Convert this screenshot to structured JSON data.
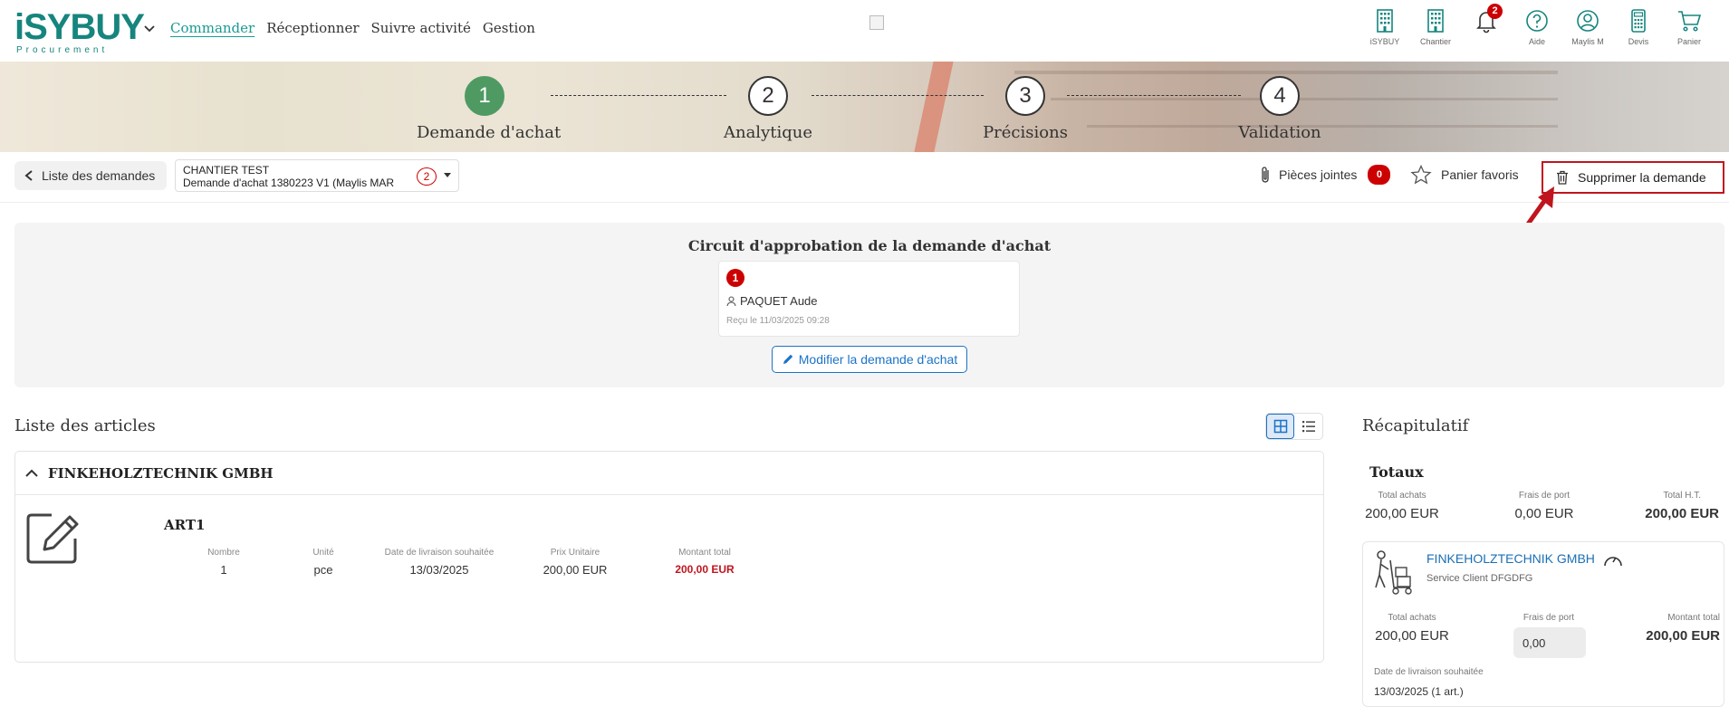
{
  "nav": {
    "logo_text": "iSYBUY",
    "logo_sub": "Procurement",
    "menu": [
      "Commander",
      "Réceptionner",
      "Suivre activité",
      "Gestion"
    ],
    "icons": [
      {
        "icon": "building-icon",
        "label": "iSYBUY"
      },
      {
        "icon": "building-icon",
        "label": "Chantier"
      },
      {
        "icon": "bell-icon",
        "label": "",
        "badge": "2"
      },
      {
        "icon": "help-icon",
        "label": "Aide"
      },
      {
        "icon": "user-icon",
        "label": "Maylis M"
      },
      {
        "icon": "calculator-icon",
        "label": "Devis"
      },
      {
        "icon": "cart-icon",
        "label": "Panier"
      }
    ]
  },
  "stepper": {
    "steps": [
      {
        "num": "1",
        "label": "Demande d'achat"
      },
      {
        "num": "2",
        "label": "Analytique"
      },
      {
        "num": "3",
        "label": "Précisions"
      },
      {
        "num": "4",
        "label": "Validation"
      }
    ]
  },
  "toolbar": {
    "back_label": "Liste des demandes",
    "cart_line1": "CHANTIER TEST",
    "cart_line2": "Demande d'achat 1380223 V1 (Maylis MAR",
    "cart_count": "2",
    "attachments_label": "Pièces jointes",
    "attachments_count": "0",
    "favorites_label": "Panier favoris",
    "delete_label": "Supprimer la demande"
  },
  "approval": {
    "title": "Circuit d'approbation de la demande d'achat",
    "step_num": "1",
    "approver": "PAQUET Aude",
    "received": "Reçu le 11/03/2025 09:28",
    "modify_label": "Modifier la demande d'achat"
  },
  "articles": {
    "title": "Liste des articles",
    "supplier": "FINKEHOLZTECHNIK GMBH",
    "item": {
      "name": "ART1",
      "headers": [
        "Nombre",
        "Unité",
        "Date de livraison souhaitée",
        "Prix Unitaire",
        "Montant total"
      ],
      "values": [
        "1",
        "pce",
        "13/03/2025",
        "200,00 EUR",
        "200,00 EUR"
      ]
    }
  },
  "recap": {
    "title": "Récapitulatif",
    "totals_title": "Totaux",
    "totals_headers": [
      "Total achats",
      "Frais de port",
      "Total H.T."
    ],
    "totals_values": [
      "200,00 EUR",
      "0,00 EUR",
      "200,00 EUR"
    ],
    "supplier_name": "FINKEHOLZTECHNIK GMBH",
    "supplier_service": "Service Client DFGDFG",
    "sup_headers": [
      "Total achats",
      "Frais de port",
      "Montant total"
    ],
    "sup_total": "200,00 EUR",
    "sup_port": "0,00",
    "sup_amount": "200,00 EUR",
    "delivery_label": "Date de livraison souhaitée",
    "delivery_value": "13/03/2025 (1 art.)"
  },
  "colors": {
    "accent": "#16857e",
    "link": "#1a73c8",
    "alert": "#c0151e",
    "step_active": "#4f9a63"
  }
}
